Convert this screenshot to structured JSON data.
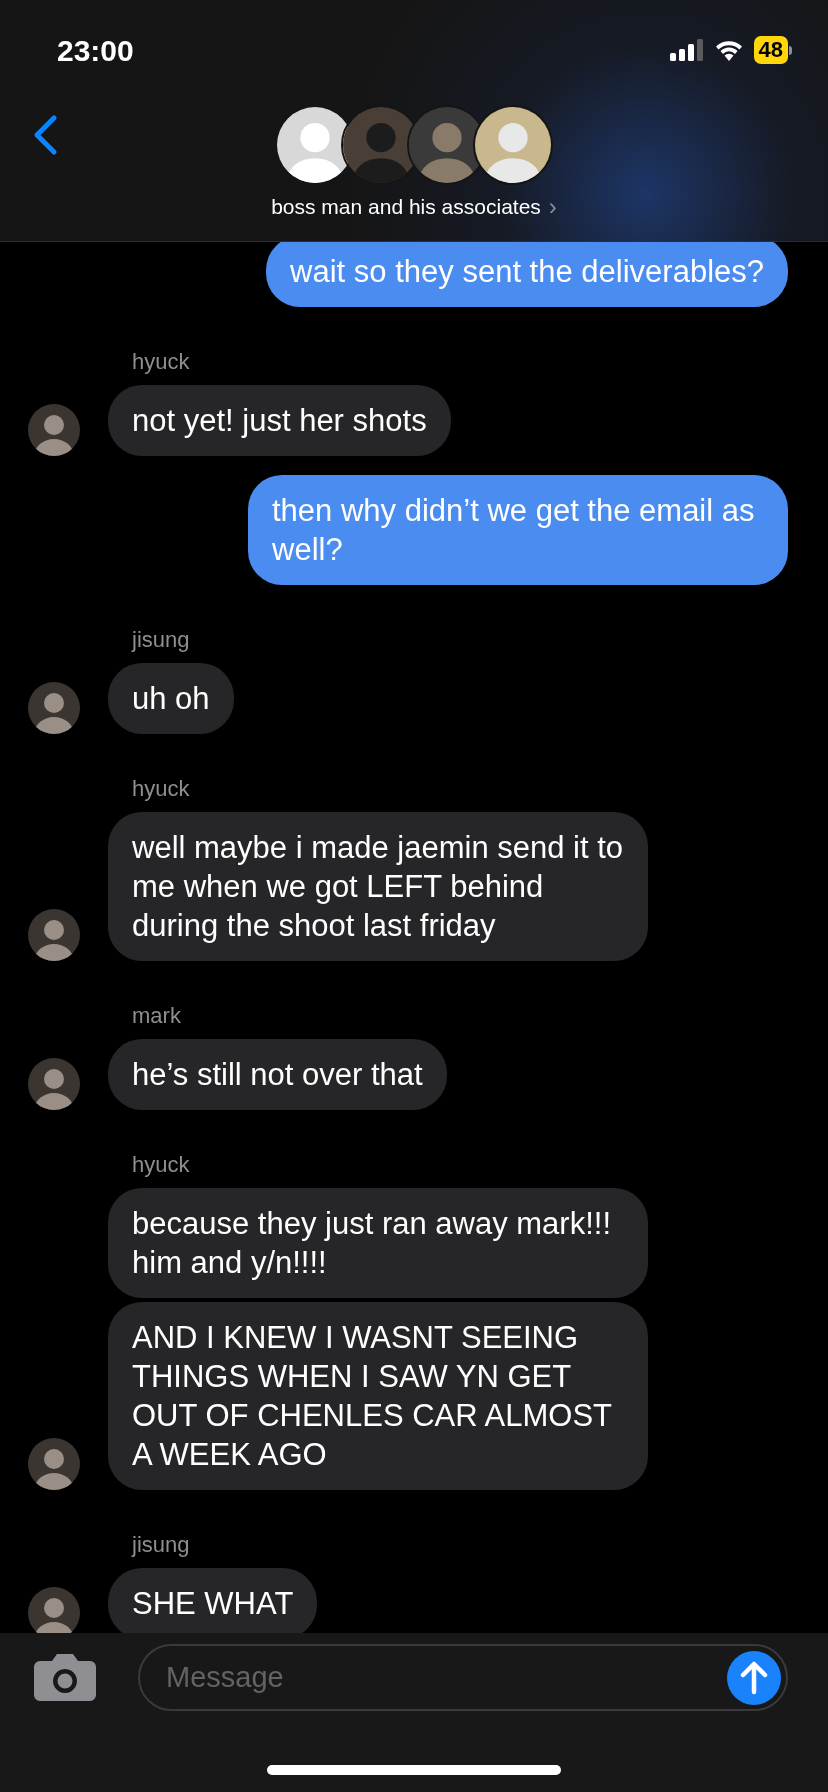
{
  "status_bar": {
    "time": "23:00",
    "battery": "48"
  },
  "header": {
    "title": "boss man and his associates",
    "chevron": "›"
  },
  "messages": [
    {
      "kind": "outgoing",
      "text": "wait so they sent the deliverables?"
    },
    {
      "kind": "incoming",
      "sender": "hyuck",
      "text": "not yet! just her shots"
    },
    {
      "kind": "outgoing",
      "text": "then why didn’t we get the email as well?"
    },
    {
      "kind": "incoming",
      "sender": "jisung",
      "text": "uh oh"
    },
    {
      "kind": "incoming",
      "sender": "hyuck",
      "text": "well maybe i made jaemin send it to me when we got LEFT behind during the shoot last friday"
    },
    {
      "kind": "incoming",
      "sender": "mark",
      "text": "he’s still not over that"
    },
    {
      "kind": "incoming",
      "sender": "hyuck",
      "text": "because they just ran away mark!!! him and y/n!!!!"
    },
    {
      "kind": "incoming",
      "text": "AND I KNEW I WASNT SEEING THINGS WHEN I SAW YN GET OUT OF CHENLES CAR ALMOST A WEEK AGO"
    },
    {
      "kind": "incoming",
      "sender": "jisung",
      "text": "SHE WHAT"
    }
  ],
  "composer": {
    "placeholder": "Message"
  }
}
